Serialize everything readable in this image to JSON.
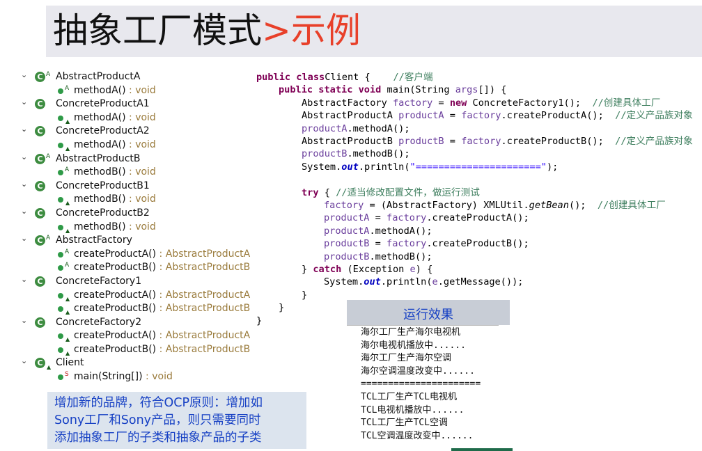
{
  "slide": {
    "title_main": "抽象工厂模式",
    "title_accent": ">示例",
    "accent_color": "#e8402a"
  },
  "tree": {
    "rows": [
      {
        "kind": "class",
        "label": "AbstractProductA",
        "mod": "A"
      },
      {
        "kind": "method",
        "label": "methodA()",
        "ret": " : void",
        "mod": "A"
      },
      {
        "kind": "class",
        "label": "ConcreteProductA1",
        "mod": ""
      },
      {
        "kind": "method",
        "label": "methodA()",
        "ret": " : void",
        "mod": "tri"
      },
      {
        "kind": "class",
        "label": "ConcreteProductA2",
        "mod": ""
      },
      {
        "kind": "method",
        "label": "methodA()",
        "ret": " : void",
        "mod": "tri"
      },
      {
        "kind": "class",
        "label": "AbstractProductB",
        "mod": "A"
      },
      {
        "kind": "method",
        "label": "methodB()",
        "ret": " : void",
        "mod": "A"
      },
      {
        "kind": "class",
        "label": "ConcreteProductB1",
        "mod": ""
      },
      {
        "kind": "method",
        "label": "methodB()",
        "ret": " : void",
        "mod": "tri"
      },
      {
        "kind": "class",
        "label": "ConcreteProductB2",
        "mod": ""
      },
      {
        "kind": "method",
        "label": "methodB()",
        "ret": " : void",
        "mod": "tri"
      },
      {
        "kind": "class",
        "label": "AbstractFactory",
        "mod": "A"
      },
      {
        "kind": "method",
        "label": "createProductA()",
        "ret": " : AbstractProductA",
        "mod": "A"
      },
      {
        "kind": "method",
        "label": "createProductB()",
        "ret": " : AbstractProductB",
        "mod": "A"
      },
      {
        "kind": "class",
        "label": "ConcreteFactory1",
        "mod": ""
      },
      {
        "kind": "method",
        "label": "createProductA()",
        "ret": " : AbstractProductA",
        "mod": "tri"
      },
      {
        "kind": "method",
        "label": "createProductB()",
        "ret": " : AbstractProductB",
        "mod": "tri"
      },
      {
        "kind": "class",
        "label": "ConcreteFactory2",
        "mod": ""
      },
      {
        "kind": "method",
        "label": "createProductA()",
        "ret": " : AbstractProductA",
        "mod": "tri"
      },
      {
        "kind": "method",
        "label": "createProductB()",
        "ret": " : AbstractProductB",
        "mod": "tri"
      },
      {
        "kind": "class",
        "label": "Client",
        "mod": "tri"
      },
      {
        "kind": "method",
        "label": "main(String[])",
        "ret": " : void",
        "mod": "S"
      }
    ]
  },
  "note": {
    "line1": "增加新的品牌，符合OCP原则：增加如",
    "line2": "Sony工厂和Sony产品，则只需要同时",
    "line3": "添加抽象工厂的子类和抽象产品的子类"
  },
  "code": {
    "lines": [
      {
        "indent": 0,
        "segs": [
          [
            "kw",
            "public class"
          ],
          [
            "",
            "Client {    "
          ],
          [
            "cm",
            "//客户端"
          ]
        ]
      },
      {
        "indent": 1,
        "segs": [
          [
            "kw",
            "public static void"
          ],
          [
            "",
            " main(String "
          ],
          [
            "var",
            "args"
          ],
          [
            "",
            "[]) {"
          ]
        ]
      },
      {
        "indent": 2,
        "segs": [
          [
            "",
            "AbstractFactory "
          ],
          [
            "var",
            "factory"
          ],
          [
            "",
            " = "
          ],
          [
            "kw",
            "new"
          ],
          [
            "",
            " ConcreteFactory1();  "
          ],
          [
            "cm",
            "//创建具体工厂"
          ]
        ]
      },
      {
        "indent": 2,
        "segs": [
          [
            "",
            "AbstractProductA "
          ],
          [
            "var",
            "productA"
          ],
          [
            "",
            " = "
          ],
          [
            "var",
            "factory"
          ],
          [
            "",
            ".createProductA();  "
          ],
          [
            "cm",
            "//定义产品族对象"
          ]
        ]
      },
      {
        "indent": 2,
        "segs": [
          [
            "var",
            "productA"
          ],
          [
            "",
            ".methodA();"
          ]
        ]
      },
      {
        "indent": 2,
        "segs": [
          [
            "",
            "AbstractProductB "
          ],
          [
            "var",
            "productB"
          ],
          [
            "",
            " = "
          ],
          [
            "var",
            "factory"
          ],
          [
            "",
            ".createProductB();  "
          ],
          [
            "cm",
            "//定义产品族对象"
          ]
        ]
      },
      {
        "indent": 2,
        "segs": [
          [
            "var",
            "productB"
          ],
          [
            "",
            ".methodB();"
          ]
        ]
      },
      {
        "indent": 2,
        "segs": [
          [
            "",
            "System."
          ],
          [
            "fld",
            "out"
          ],
          [
            "",
            ".println("
          ],
          [
            "str",
            "\"======================\""
          ],
          [
            "",
            ");"
          ]
        ]
      },
      {
        "indent": 0,
        "segs": []
      },
      {
        "indent": 2,
        "segs": [
          [
            "kw",
            "try"
          ],
          [
            "",
            " { "
          ],
          [
            "cm",
            "//适当修改配置文件，做运行测试"
          ]
        ]
      },
      {
        "indent": 3,
        "segs": [
          [
            "var",
            "factory"
          ],
          [
            "",
            " = (AbstractFactory) XMLUtil."
          ],
          [
            "ital",
            "getBean"
          ],
          [
            "",
            "();  "
          ],
          [
            "cm",
            "//创建具体工厂"
          ]
        ]
      },
      {
        "indent": 3,
        "segs": [
          [
            "var",
            "productA"
          ],
          [
            "",
            " = "
          ],
          [
            "var",
            "factory"
          ],
          [
            "",
            ".createProductA();"
          ]
        ]
      },
      {
        "indent": 3,
        "segs": [
          [
            "var",
            "productA"
          ],
          [
            "",
            ".methodA();"
          ]
        ]
      },
      {
        "indent": 3,
        "segs": [
          [
            "var",
            "productB"
          ],
          [
            "",
            " = "
          ],
          [
            "var",
            "factory"
          ],
          [
            "",
            ".createProductB();"
          ]
        ]
      },
      {
        "indent": 3,
        "segs": [
          [
            "var",
            "productB"
          ],
          [
            "",
            ".methodB();"
          ]
        ]
      },
      {
        "indent": 2,
        "segs": [
          [
            "",
            "} "
          ],
          [
            "kw",
            "catch"
          ],
          [
            "",
            " (Exception "
          ],
          [
            "var",
            "e"
          ],
          [
            "",
            ") {"
          ]
        ]
      },
      {
        "indent": 3,
        "segs": [
          [
            "",
            "System."
          ],
          [
            "fld",
            "out"
          ],
          [
            "",
            ".println("
          ],
          [
            "var",
            "e"
          ],
          [
            "",
            ".getMessage());"
          ]
        ]
      },
      {
        "indent": 2,
        "segs": [
          [
            "",
            "}"
          ]
        ]
      },
      {
        "indent": 1,
        "segs": [
          [
            "",
            "}"
          ]
        ]
      },
      {
        "indent": 0,
        "segs": [
          [
            "",
            "}"
          ]
        ]
      }
    ]
  },
  "result": {
    "heading": "运行效果",
    "lines": [
      "海尔工厂生产海尔电视机",
      "海尔电视机播放中......",
      "海尔工厂生产海尔空调",
      "海尔空调温度改变中......",
      "======================",
      "TCL工厂生产TCL电视机",
      "TCL电视机播放中......",
      "TCL工厂生产TCL空调",
      "TCL空调温度改变中......"
    ]
  }
}
